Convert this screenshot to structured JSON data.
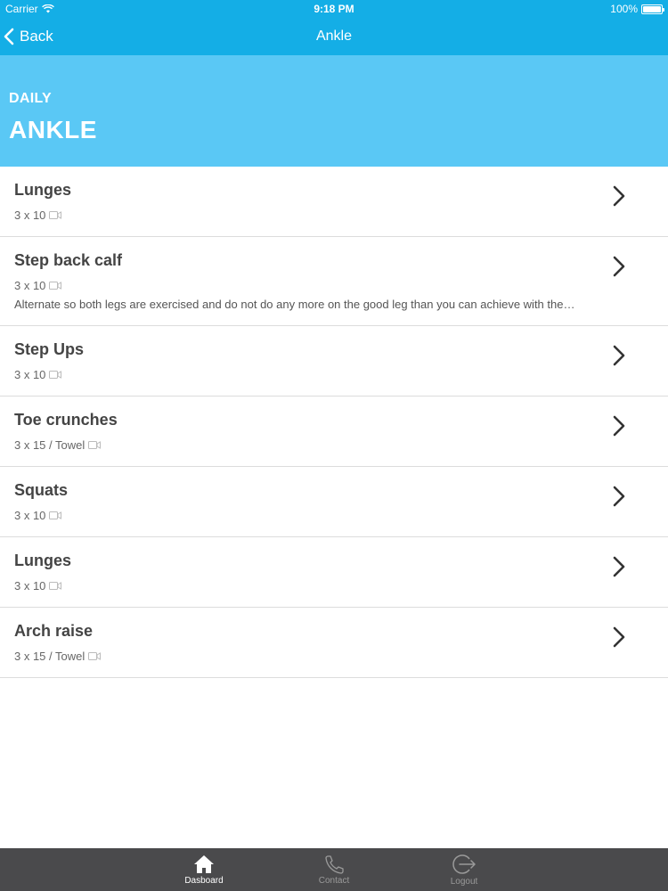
{
  "status": {
    "carrier": "Carrier",
    "time": "9:18 PM",
    "battery": "100%"
  },
  "nav": {
    "back_label": "Back",
    "title": "Ankle"
  },
  "header": {
    "subtitle": "DAILY",
    "title": "ANKLE"
  },
  "exercises": [
    {
      "name": "Lunges",
      "meta": "3 x 10",
      "description": ""
    },
    {
      "name": "Step back calf",
      "meta": "3 x 10",
      "description": "Alternate so both legs are exercised and do not do any more on the good leg than you can achieve with the…"
    },
    {
      "name": "Step Ups",
      "meta": "3 x 10",
      "description": ""
    },
    {
      "name": "Toe crunches",
      "meta": "3 x 15 / Towel",
      "description": ""
    },
    {
      "name": "Squats",
      "meta": "3 x 10",
      "description": ""
    },
    {
      "name": "Lunges",
      "meta": "3 x 10",
      "description": ""
    },
    {
      "name": "Arch raise",
      "meta": "3 x 15 / Towel",
      "description": ""
    }
  ],
  "tabs": [
    {
      "label": "Dasboard",
      "icon": "home-icon",
      "active": true
    },
    {
      "label": "Contact",
      "icon": "phone-icon",
      "active": false
    },
    {
      "label": "Logout",
      "icon": "logout-icon",
      "active": false
    }
  ],
  "colors": {
    "nav": "#14aee6",
    "banner": "#5ac8f5",
    "tabbar": "#4a4a4c"
  }
}
